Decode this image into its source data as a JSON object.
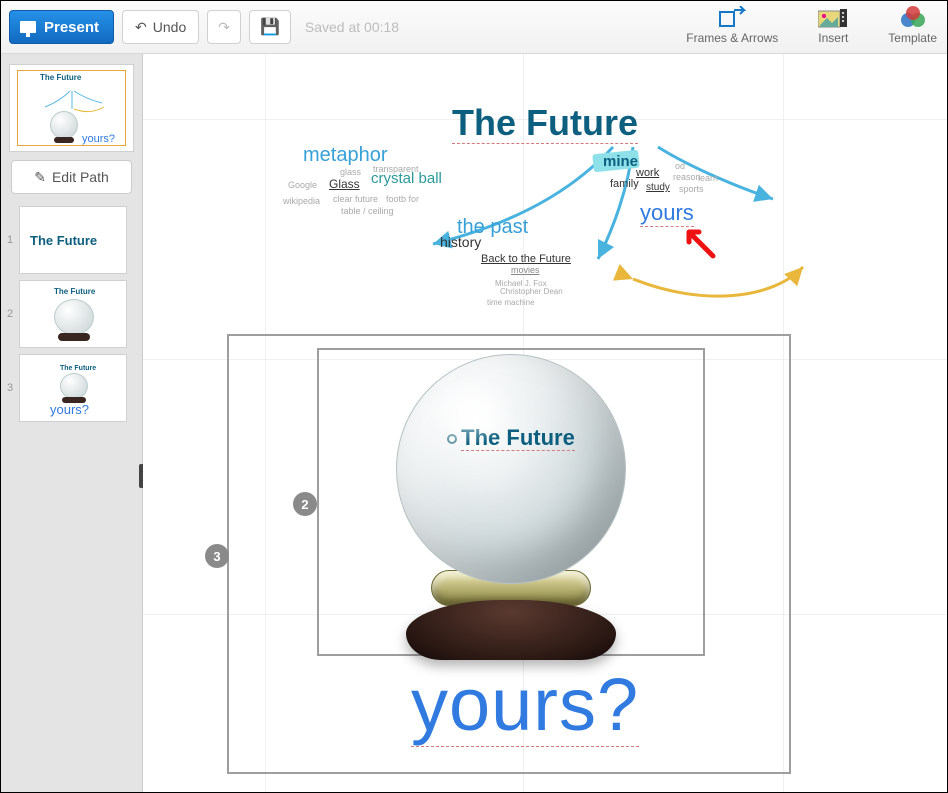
{
  "toolbar": {
    "present": "Present",
    "undo": "Undo",
    "saved": "Saved at 00:18",
    "frames": "Frames & Arrows",
    "insert": "Insert",
    "template": "Template"
  },
  "sidebar": {
    "edit_path": "Edit Path",
    "overview": {
      "title": "The Future",
      "sub": "yours?"
    },
    "thumbs": [
      {
        "num": "1",
        "label": "The Future"
      },
      {
        "num": "2",
        "label": "The Future"
      },
      {
        "num": "3",
        "label": "The Future",
        "sub": "yours?"
      }
    ]
  },
  "canvas": {
    "title": "The Future",
    "words": {
      "metaphor": "metaphor",
      "crystal": "crystal ball",
      "glass": "Glass",
      "transparent": "transparent",
      "google": "Google",
      "wikipedia": "wikipedia",
      "glass2": "glass",
      "clear": "clear future",
      "footb": "footb for",
      "table": "table / ceiling",
      "past": "the past",
      "history": "history",
      "back": "Back to the Future",
      "movies": "movies",
      "char": "Christopher Dean",
      "label": "Michael J. Fox",
      "tm": "time machine",
      "mine": "mine",
      "work": "work",
      "family": "family",
      "study": "study",
      "reason": "reason",
      "sports": "sports",
      "od": "od",
      "learn": "learn",
      "yours": "yours"
    },
    "ball_title": "The Future",
    "yours_big": "yours?",
    "badges": {
      "b2": "2",
      "b3": "3"
    }
  }
}
